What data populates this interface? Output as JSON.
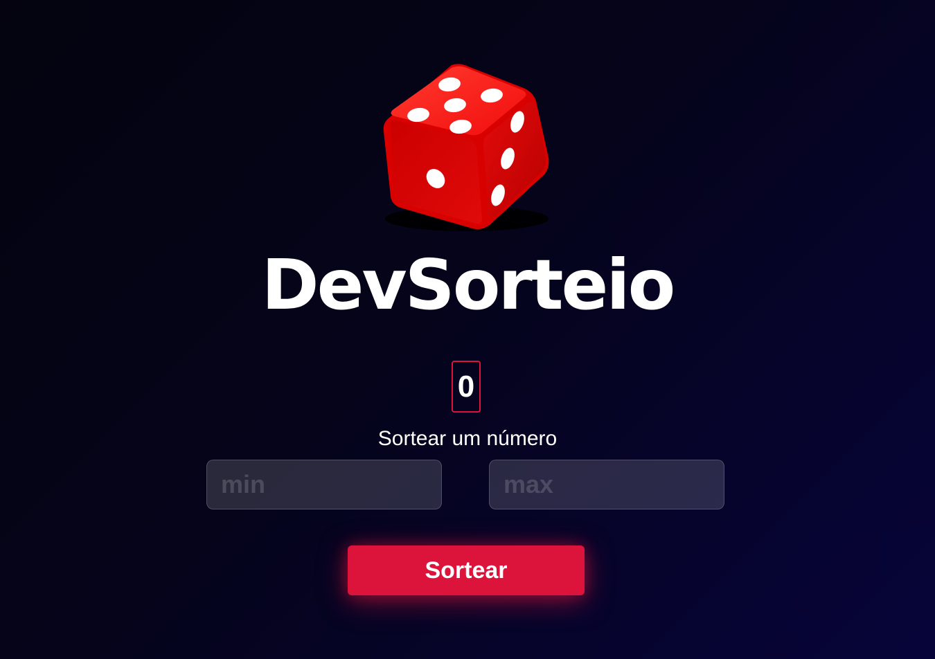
{
  "app": {
    "title": "DevSorteio",
    "logo_icon": "dice-icon"
  },
  "result": {
    "value": "0"
  },
  "form": {
    "subtitle": "Sortear um número",
    "min_placeholder": "min",
    "max_placeholder": "max",
    "min_value": "",
    "max_value": "",
    "submit_label": "Sortear"
  },
  "colors": {
    "accent": "#dc143c",
    "background_dark": "#04030f",
    "background_light": "#07043a",
    "dice_red": "#e60000"
  }
}
